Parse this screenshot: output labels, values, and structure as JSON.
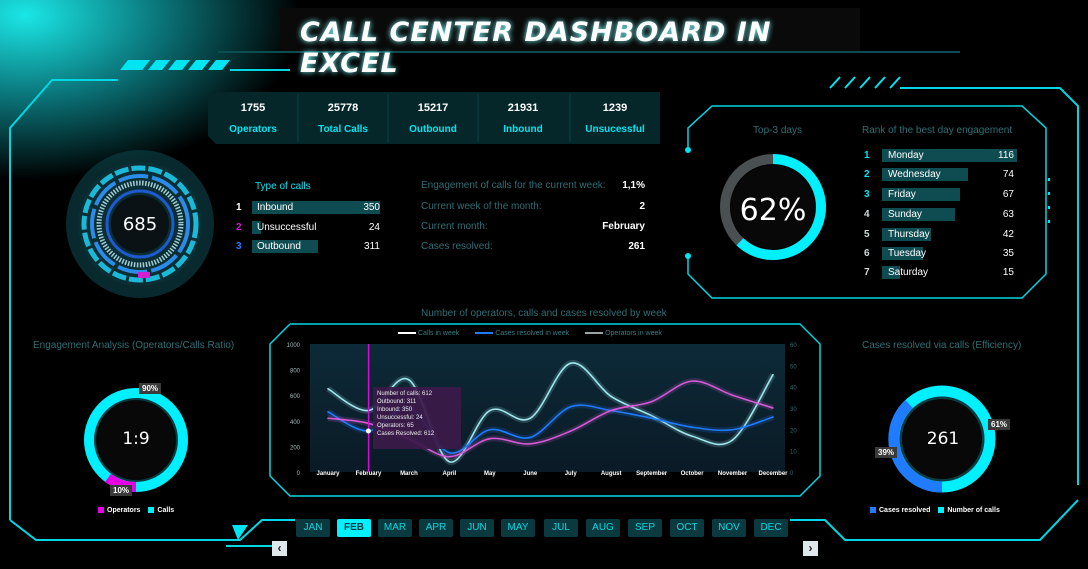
{
  "title": "CALL CENTER DASHBOARD IN EXCEL",
  "kpis": [
    {
      "value": "1755",
      "label": "Operators"
    },
    {
      "value": "25778",
      "label": "Total Calls"
    },
    {
      "value": "15217",
      "label": "Outbound"
    },
    {
      "value": "21931",
      "label": "Inbound"
    },
    {
      "value": "1239",
      "label": "Unsucessful"
    }
  ],
  "gauge": {
    "value": "685"
  },
  "type_of_calls": {
    "title": "Type of calls",
    "rows": [
      {
        "num": "1",
        "label": "Inbound",
        "value": "350",
        "color": "#ffffff"
      },
      {
        "num": "2",
        "label": "Unsuccessful",
        "value": "24",
        "color": "#d21fd6"
      },
      {
        "num": "3",
        "label": "Outbound",
        "value": "311",
        "color": "#2c7bff"
      }
    ]
  },
  "info": [
    {
      "label": "Engagement of calls for the current week:",
      "value": "1,1%"
    },
    {
      "label": "Current week of the month:",
      "value": "2"
    },
    {
      "label": "Current month:",
      "value": "February"
    },
    {
      "label": "Cases resolved:",
      "value": "261"
    }
  ],
  "top3": {
    "title": "Top-3 days",
    "percent": "62%",
    "fraction": 0.62
  },
  "rank": {
    "title": "Rank of the best day engagement",
    "rows": [
      {
        "num": "1",
        "day": "Monday",
        "value": "116"
      },
      {
        "num": "2",
        "day": "Wednesday",
        "value": "74"
      },
      {
        "num": "3",
        "day": "Friday",
        "value": "67"
      },
      {
        "num": "4",
        "day": "Sunday",
        "value": "63"
      },
      {
        "num": "5",
        "day": "Thursday",
        "value": "42"
      },
      {
        "num": "6",
        "day": "Tuesday",
        "value": "35"
      },
      {
        "num": "7",
        "day": "Saturday",
        "value": "15"
      }
    ]
  },
  "engagement": {
    "title": "Engagement Analysis (Operators/Calls Ratio)",
    "ratio": "1:9",
    "pct_calls": "90%",
    "pct_operators": "10%",
    "legend": [
      "Operators",
      "Calls"
    ]
  },
  "efficiency": {
    "title": "Cases resolved via calls (Efficiency)",
    "value": "261",
    "pct_resolved": "39%",
    "pct_calls": "61%",
    "legend": [
      "Cases resolved",
      "Number of calls"
    ]
  },
  "chart_title": "Number of operators, calls and cases resolved by week",
  "chart_data": {
    "type": "line",
    "legend": [
      "Calls in week",
      "Cases resolved in week",
      "Operators in week"
    ],
    "categories": [
      "January",
      "February",
      "March",
      "April",
      "May",
      "June",
      "July",
      "August",
      "September",
      "October",
      "November",
      "December"
    ],
    "y_left_ticks": [
      "0",
      "200",
      "400",
      "600",
      "800",
      "1000"
    ],
    "y_right_ticks": [
      "0",
      "10",
      "20",
      "30",
      "40",
      "50",
      "60"
    ],
    "ylim_left": [
      0,
      1000
    ],
    "ylim_right": [
      0,
      60
    ],
    "tooltip": [
      "Number of calls: 612",
      "Outbound: 311",
      "Inbound: 350",
      "Unsuccessful: 24",
      "Operators: 65",
      "Cases Resolved: 612"
    ],
    "series": [
      {
        "name": "Calls in week",
        "color": "#9fe8ee",
        "values": [
          650,
          480,
          720,
          80,
          480,
          420,
          850,
          590,
          440,
          280,
          250,
          760
        ]
      },
      {
        "name": "Cases resolved in week",
        "color": "#1f7bff",
        "values": [
          470,
          320,
          500,
          150,
          330,
          270,
          510,
          480,
          420,
          350,
          330,
          430
        ]
      },
      {
        "name": "Operators in week",
        "color": "#d65ad6",
        "values": [
          420,
          380,
          260,
          120,
          260,
          220,
          320,
          480,
          550,
          710,
          600,
          500
        ]
      }
    ]
  },
  "months": [
    "JAN",
    "FEB",
    "MAR",
    "APR",
    "JUN",
    "MAY",
    "JUL",
    "AUG",
    "SEP",
    "OCT",
    "NOV",
    "DEC"
  ],
  "active_month": "FEB",
  "colors": {
    "accent": "#00e5f2",
    "dim": "#2f6f74",
    "panel": "#0f4c52"
  }
}
